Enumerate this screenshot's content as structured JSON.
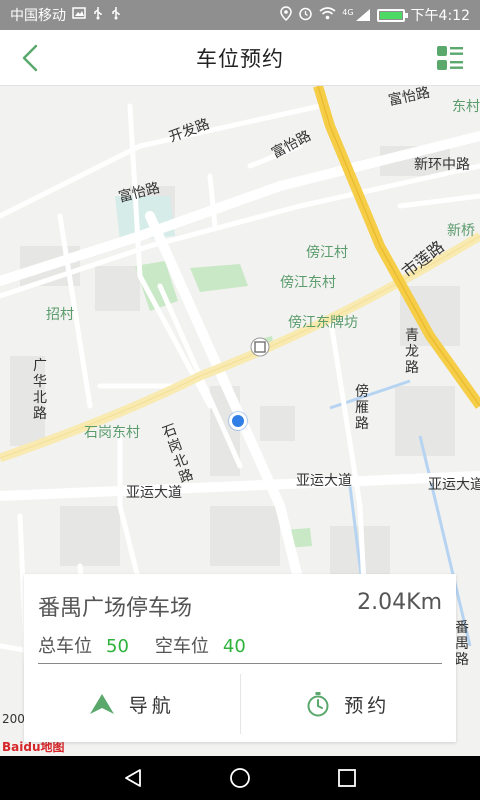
{
  "status_bar": {
    "carrier": "中国移动",
    "network": "4G",
    "time": "下午4:12"
  },
  "header": {
    "title": "车位预约"
  },
  "map": {
    "labels": {
      "kaifa_road": "开发路",
      "fuyi_road_1": "富怡路",
      "fuyi_road_2": "富怡路",
      "fuyi_road_3": "富怡路",
      "dongcun": "东村",
      "xinhuan_middle_road": "新环中路",
      "xinqiao": "新桥",
      "bangjiang_village": "傍江村",
      "bangjiang_east_village": "傍江东村",
      "shilian_road": "市莲路",
      "zhaocun": "招村",
      "bangjiang_east_archway": "傍江东牌坊",
      "qinglong_road": "青龙路",
      "guanghua_north_road": "广华北路",
      "bangya_road": "傍雁路",
      "shigang_east_village": "石岗东村",
      "shigang_north_road": "石岗北路",
      "yayun_avenue_1": "亚运大道",
      "yayun_avenue_2": "亚运大道",
      "yayun_avenue_3": "亚运大道",
      "panyu_road": "番禺路"
    },
    "scale": "200",
    "logo": "Baidu地图"
  },
  "parking": {
    "name": "番禺广场停车场",
    "distance": "2.04Km",
    "total_label": "总车位",
    "total_value": "50",
    "free_label": "空车位",
    "free_value": "40"
  },
  "actions": {
    "navigate": "导航",
    "reserve": "预约"
  },
  "colors": {
    "accent_green": "#2db33a",
    "icon_green": "#5aa86c",
    "highway_yellow": "#f5cd46",
    "location_blue": "#2f7fe6"
  }
}
